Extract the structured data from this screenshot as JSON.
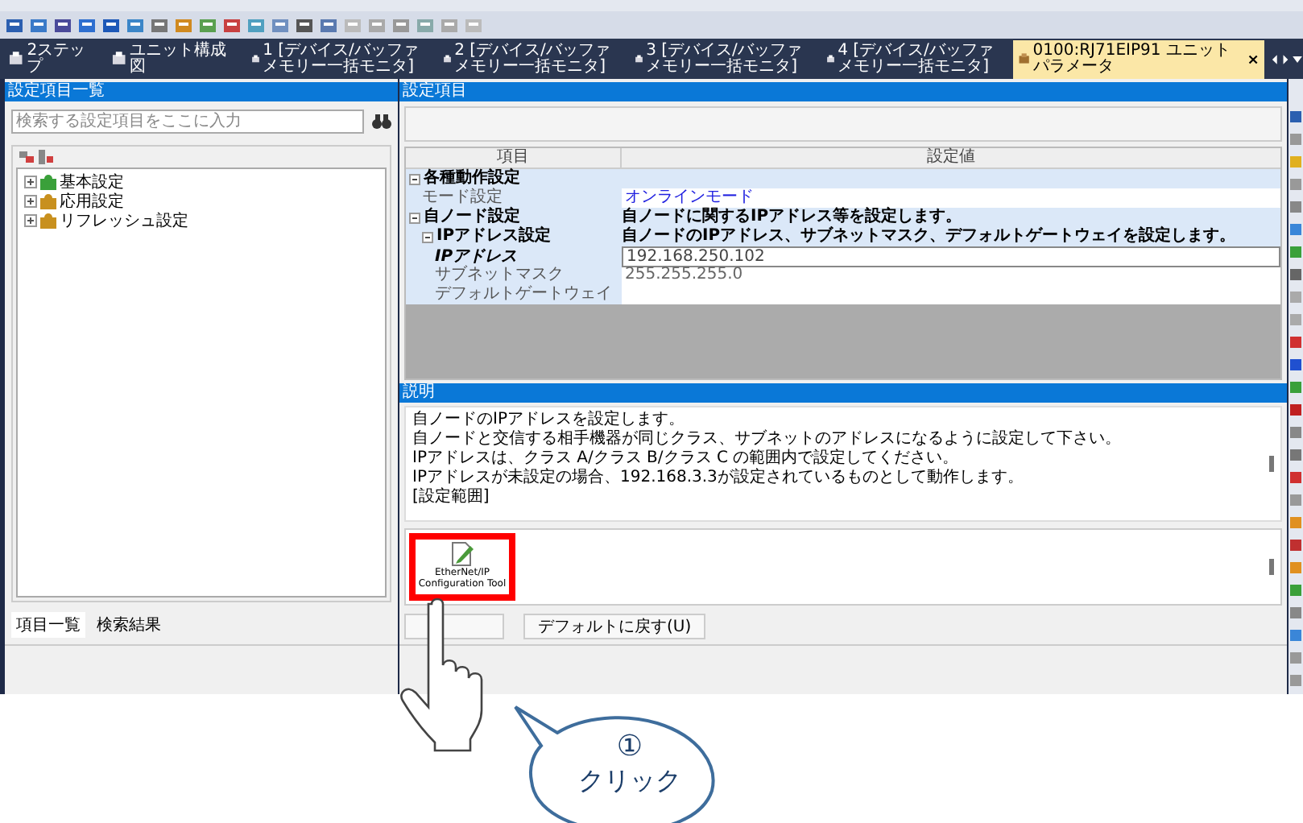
{
  "tabs": [
    {
      "label": "2ステップ",
      "selected": false
    },
    {
      "label": "ユニット構成図",
      "selected": false
    },
    {
      "label": "1 [デバイス/バッファメモリー一括モニタ]",
      "selected": false
    },
    {
      "label": "2 [デバイス/バッファメモリー一括モニタ]",
      "selected": false
    },
    {
      "label": "3 [デバイス/バッファメモリー一括モニタ]",
      "selected": false
    },
    {
      "label": "4 [デバイス/バッファメモリー一括モニタ]",
      "selected": false
    },
    {
      "label": "0100:RJ71EIP91 ユニットパラメータ",
      "selected": true
    }
  ],
  "left_panel": {
    "title": "設定項目一覧",
    "search": {
      "placeholder": "検索する設定項目をここに入力"
    },
    "tree": [
      {
        "label": "基本設定",
        "color": "#3aa03a"
      },
      {
        "label": "応用設定",
        "color": "#c8901e"
      },
      {
        "label": "リフレッシュ設定",
        "color": "#c8901e"
      }
    ],
    "bottom_tabs": [
      {
        "label": "項目一覧",
        "selected": true
      },
      {
        "label": "検索結果",
        "selected": false
      }
    ]
  },
  "settings": {
    "title": "設定項目",
    "columns": [
      "項目",
      "設定値"
    ],
    "rows": [
      {
        "item": "各種動作設定",
        "kind": "group",
        "expanded": true,
        "children": [
          {
            "item": "モード設定",
            "kind": "choice",
            "value": "オンラインモード",
            "selected": false
          }
        ]
      },
      {
        "item": "自ノード設定",
        "kind": "group",
        "expanded": true,
        "value": "自ノードに関するIPアドレス等を設定します。",
        "children": [
          {
            "item": "IPアドレス設定",
            "kind": "group",
            "expanded": true,
            "value": "自ノードのIPアドレス、サブネットマスク、デフォルトゲートウェイを設定します。",
            "children": [
              {
                "item": "IPアドレス",
                "kind": "input",
                "value": "192.168.250.102",
                "selected": true
              },
              {
                "item": "サブネットマスク",
                "kind": "text",
                "value": "255.255.255.0",
                "selected": false
              },
              {
                "item": "デフォルトゲートウェイ",
                "kind": "input",
                "selected": false
              }
            ]
          }
        ]
      }
    ]
  },
  "description": {
    "title": "説明",
    "lines": [
      "自ノードのIPアドレスを設定します。",
      "自ノードと交信する相手機器が同じクラス、サブネットのアドレスになるように設定して下さい。",
      "IPアドレスは、クラス A/クラス B/クラス C の範囲内で設定してください。",
      "IPアドレスが未設定の場合、192.168.3.3が設定されているものとして動作します。",
      "[設定範囲]"
    ]
  },
  "tool": {
    "label": "EtherNet/IP Configuration Tool",
    "highlighted": true
  },
  "buttons": [
    "デフォルトに戻す(U)"
  ],
  "callout": {
    "number": "①",
    "text": "クリック"
  }
}
